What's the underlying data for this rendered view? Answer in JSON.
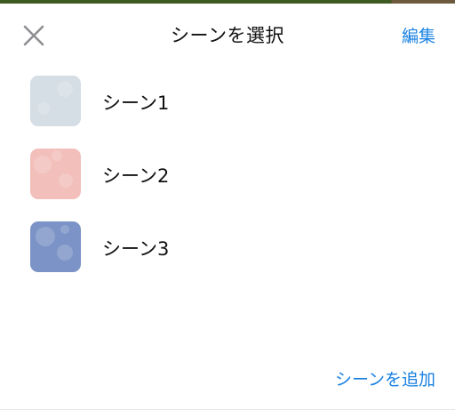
{
  "header": {
    "title": "シーンを選択",
    "edit_label": "編集",
    "close_icon": "close-icon"
  },
  "scenes": [
    {
      "label": "シーン1",
      "color": "#d5dde5"
    },
    {
      "label": "シーン2",
      "color": "#f2bfbb"
    },
    {
      "label": "シーン3",
      "color": "#7b93c6"
    }
  ],
  "footer": {
    "add_label": "シーンを追加"
  },
  "colors": {
    "accent": "#1a82e2",
    "text": "#111111",
    "icon": "#8e8e93"
  }
}
